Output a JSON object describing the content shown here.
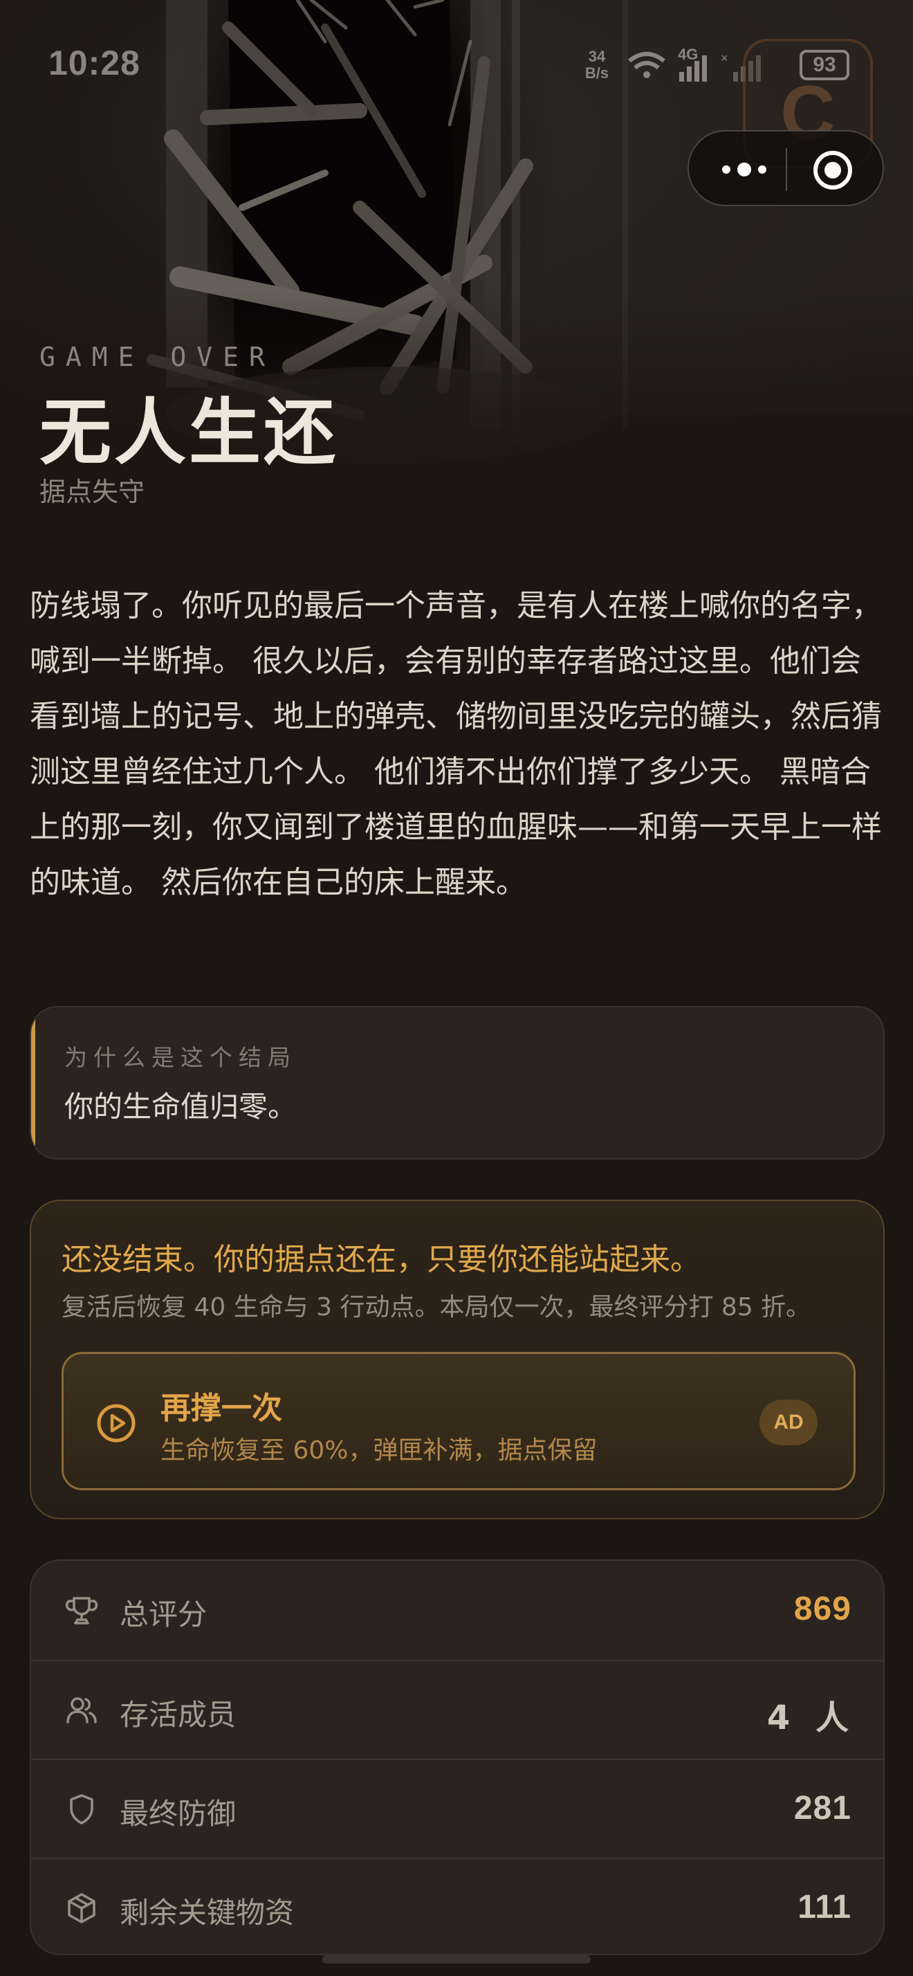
{
  "status_bar": {
    "time": "10:28",
    "speed_value": "34",
    "speed_unit": "B/s",
    "network": "4G",
    "battery": "93"
  },
  "watermark": {
    "letter": "C"
  },
  "capsule": {
    "more_icon": "more-dots-icon",
    "close_icon": "close-circle-icon"
  },
  "header": {
    "eyebrow": "GAME OVER",
    "title": "无人生还",
    "subtitle": "据点失守"
  },
  "story": "防线塌了。你听见的最后一个声音，是有人在楼上喊你的名字，喊到一半断掉。 很久以后，会有别的幸存者路过这里。他们会看到墙上的记号、地上的弹壳、储物间里没吃完的罐头，然后猜测这里曾经住过几个人。 他们猜不出你们撑了多少天。 黑暗合上的那一刻，你又闻到了楼道里的血腥味——和第一天早上一样的味道。 然后你在自己的床上醒来。",
  "why": {
    "label": "为什么是这个结局",
    "text": "你的生命值归零。"
  },
  "revive": {
    "headline": "还没结束。你的据点还在，只要你还能站起来。",
    "description": "复活后恢复 40 生命与 3 行动点。本局仅一次，最终评分打 85 折。",
    "button": {
      "title": "再撑一次",
      "subtitle": "生命恢复至 60%，弹匣补满，据点保留",
      "badge": "AD",
      "icon": "play-circle-icon"
    }
  },
  "stats": [
    {
      "icon": "trophy-icon",
      "label": "总评分",
      "value": "869"
    },
    {
      "icon": "users-icon",
      "label": "存活成员",
      "value": "4 人"
    },
    {
      "icon": "shield-icon",
      "label": "最终防御",
      "value": "281"
    },
    {
      "icon": "package-icon",
      "label": "剩余关键物资",
      "value": "111"
    }
  ],
  "colors": {
    "accent": "#e0a54a",
    "background": "#1c1613",
    "card": "#2a2320",
    "text": "#e9e1d6"
  }
}
